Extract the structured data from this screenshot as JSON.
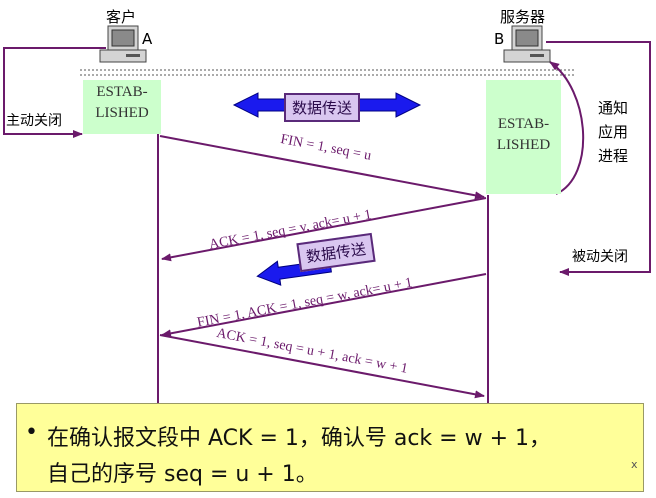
{
  "client": {
    "title": "客户",
    "letter": "A",
    "state": "ESTAB-\nLISHED",
    "close_label": "主动关闭"
  },
  "server": {
    "title": "服务器",
    "letter": "B",
    "state": "ESTAB-\nLISHED",
    "notify_label": "通知\n应用\n进程",
    "passive_close_label": "被动关闭"
  },
  "data_transfer_1": "数据传送",
  "data_transfer_2": "数据传送",
  "messages": [
    "FIN = 1, seq = u",
    "ACK = 1, seq = v, ack= u + 1",
    "FIN = 1, ACK = 1, seq = w, ack= u + 1",
    "ACK = 1, seq = u + 1, ack = w + 1"
  ],
  "note": {
    "bullet": "•",
    "line1": "在确认报文段中 ACK = 1，确认号 ack = w + 1，",
    "line2": "自己的序号 seq = u + 1。",
    "corner": "x"
  },
  "colors": {
    "arrow": "#6b1a6b",
    "state_bg": "#ccffcc",
    "data_arrow": "#0000cc",
    "note_bg": "#ffff99"
  }
}
